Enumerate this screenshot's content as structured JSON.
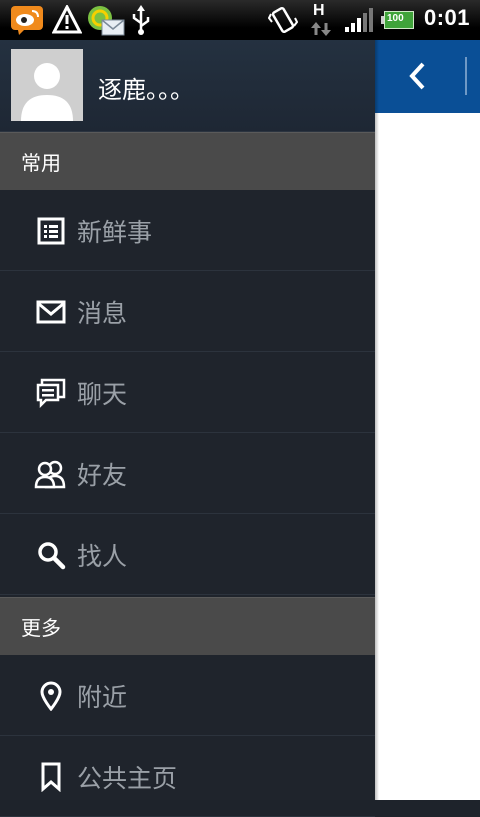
{
  "status_bar": {
    "time": "0:01",
    "network_type": "H",
    "battery_level": "100",
    "icons": [
      "weibo-icon",
      "alert-icon",
      "message-icon",
      "usb-icon",
      "vibrate-icon",
      "network-h-icon",
      "signal-icon",
      "battery-icon"
    ]
  },
  "profile": {
    "username": "逐鹿。。。"
  },
  "sections": [
    {
      "title": "常用",
      "items": [
        {
          "label": "新鲜事",
          "icon": "news-feed-icon"
        },
        {
          "label": "消息",
          "icon": "envelope-icon"
        },
        {
          "label": "聊天",
          "icon": "chat-icon"
        },
        {
          "label": "好友",
          "icon": "friends-icon"
        },
        {
          "label": "找人",
          "icon": "search-icon"
        }
      ]
    },
    {
      "title": "更多",
      "items": [
        {
          "label": "附近",
          "icon": "location-pin-icon"
        },
        {
          "label": "公共主页",
          "icon": "bookmark-icon"
        }
      ]
    }
  ],
  "colors": {
    "drawer_bg": "#1f242c",
    "section_header_bg": "#4a4a4a",
    "menu_text": "#9aa0a7",
    "header_blue": "#0a4f96"
  }
}
